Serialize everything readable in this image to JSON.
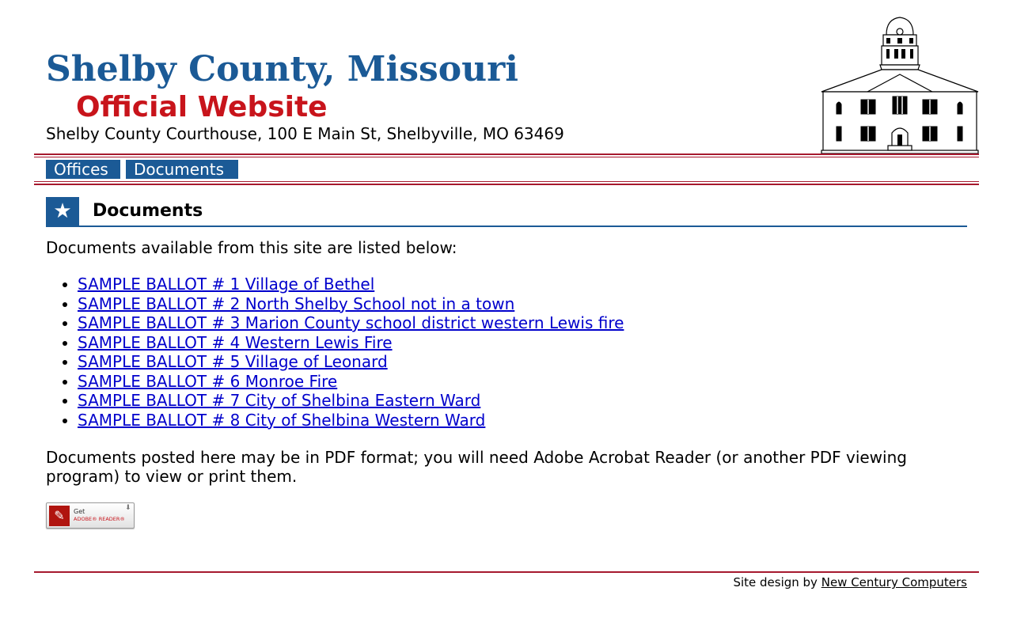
{
  "header": {
    "title": "Shelby County, Missouri",
    "subtitle": "Official Website",
    "address": "Shelby County Courthouse, 100 E Main St, Shelbyville, MO 63469"
  },
  "nav": {
    "items": [
      {
        "label": "Offices"
      },
      {
        "label": "Documents"
      }
    ]
  },
  "section": {
    "title": "Documents",
    "icon": "star-icon",
    "intro": "Documents available from this site are listed below:"
  },
  "documents": [
    {
      "label": "SAMPLE BALLOT # 1 Village of Bethel"
    },
    {
      "label": "SAMPLE BALLOT # 2 North Shelby School not in a town"
    },
    {
      "label": "SAMPLE BALLOT # 3 Marion County school district western Lewis fire"
    },
    {
      "label": "SAMPLE BALLOT # 4 Western Lewis Fire"
    },
    {
      "label": "SAMPLE BALLOT # 5 Village of Leonard"
    },
    {
      "label": "SAMPLE BALLOT # 6 Monroe Fire"
    },
    {
      "label": "SAMPLE BALLOT # 7 City of Shelbina Eastern Ward"
    },
    {
      "label": "SAMPLE BALLOT # 8 City of Shelbina Western Ward"
    }
  ],
  "pdf_note": "Documents posted here may be in PDF format; you will need Adobe Acrobat Reader (or another PDF viewing program) to view or print them.",
  "adobe_badge": {
    "get": "Get",
    "reader": "ADOBE® READER®"
  },
  "footer": {
    "prefix": "Site design by",
    "link": "New Century Computers"
  },
  "colors": {
    "brand_blue": "#1b5a96",
    "brand_red": "#c8141b",
    "rule_red": "#a6192e",
    "link": "#0000cc"
  }
}
